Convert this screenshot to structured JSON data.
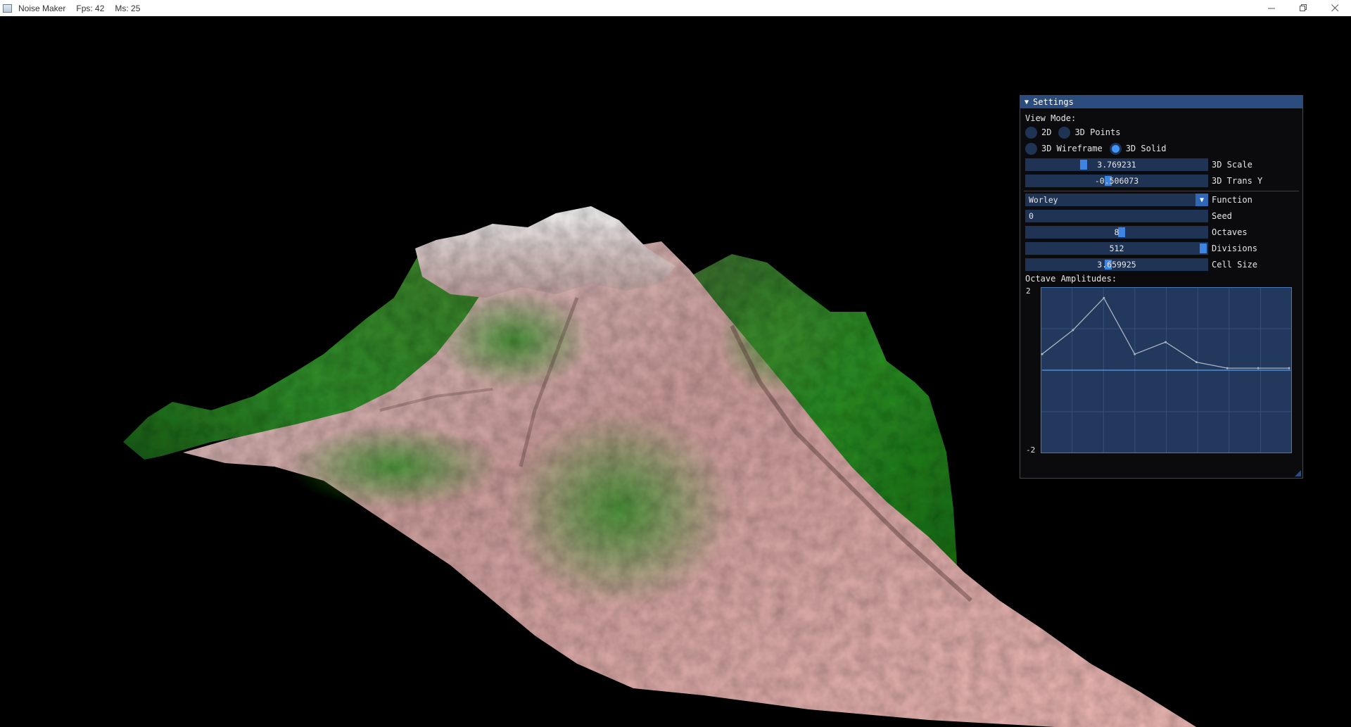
{
  "window": {
    "title": "Noise Maker",
    "fps": "Fps: 42",
    "ms": "Ms: 25"
  },
  "settings": {
    "title": "Settings",
    "view_mode_label": "View Mode:",
    "view_modes": [
      {
        "label": "2D",
        "selected": false
      },
      {
        "label": "3D Points",
        "selected": false
      },
      {
        "label": "3D Wireframe",
        "selected": false
      },
      {
        "label": "3D Solid",
        "selected": true
      }
    ],
    "scale": {
      "value": "3.769231",
      "label": "3D Scale",
      "level": 0.31
    },
    "trans_y": {
      "value": "-0.506073",
      "label": "3D Trans Y",
      "level": 0.45
    },
    "function": {
      "value": "Worley",
      "label": "Function"
    },
    "seed": {
      "value": "0",
      "label": "Seed"
    },
    "octaves": {
      "value": "8",
      "label": "Octaves",
      "level": 0.53
    },
    "divisions": {
      "value": "512",
      "label": "Divisions",
      "level": 1.0
    },
    "cell_size": {
      "value": "3.659925",
      "label": "Cell Size",
      "level": 0.45
    },
    "amplitudes": {
      "label": "Octave Amplitudes:",
      "ymax": "2",
      "ymin": "-2",
      "values": [
        0.4,
        1.0,
        1.8,
        0.4,
        0.7,
        0.2,
        0.05,
        0.05,
        0.05
      ]
    }
  },
  "colors": {
    "accent": "#4296fa",
    "frame_bg": "#1f3354",
    "title_bg": "#2d4c7e"
  }
}
